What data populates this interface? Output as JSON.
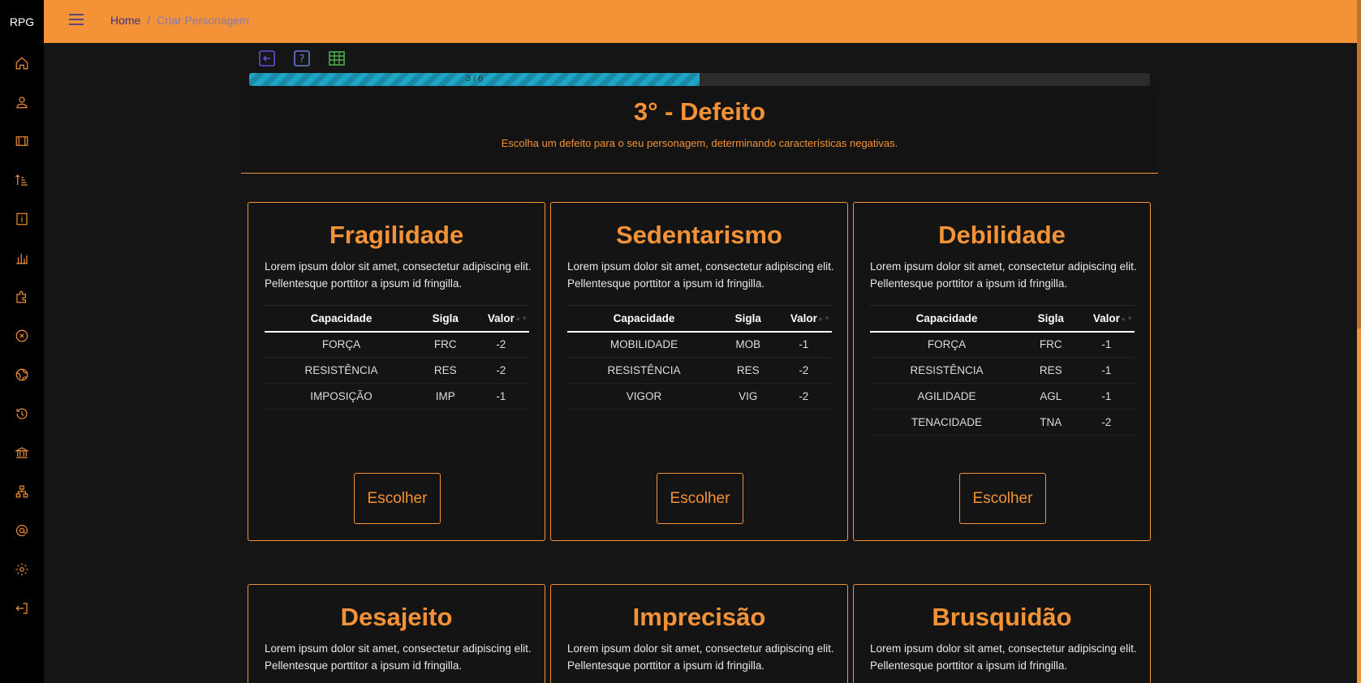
{
  "app": {
    "brand": "RPG"
  },
  "breadcrumb": {
    "home": "Home",
    "separator": "/",
    "current": "Criar Personagem"
  },
  "sidebar": {
    "items": [
      {
        "icon": "home-icon"
      },
      {
        "icon": "user-icon"
      },
      {
        "icon": "film-icon"
      },
      {
        "icon": "sort-ascending-icon"
      },
      {
        "icon": "info-icon"
      },
      {
        "icon": "bar-chart-icon"
      },
      {
        "icon": "puzzle-icon"
      },
      {
        "icon": "close-circle-icon"
      },
      {
        "icon": "globe-icon"
      },
      {
        "icon": "history-icon"
      },
      {
        "icon": "bank-icon"
      },
      {
        "icon": "sitemap-icon"
      },
      {
        "icon": "at-icon"
      },
      {
        "icon": "gear-icon"
      },
      {
        "icon": "logout-icon"
      }
    ]
  },
  "tools": [
    {
      "icon": "back-arrow-icon"
    },
    {
      "icon": "help-icon"
    },
    {
      "icon": "table-icon"
    }
  ],
  "progress": {
    "label": "3 / 6",
    "value": 0.5
  },
  "step": {
    "title": "3° - Defeito",
    "subtitle": "Escolha um defeito para o seu personagem, determinando características negativas."
  },
  "table_headers": {
    "capacidade": "Capacidade",
    "sigla": "Sigla",
    "valor": "Valor"
  },
  "choose_label": "Escolher",
  "cards": [
    {
      "title": "Fragilidade",
      "description": "Lorem ipsum dolor sit amet, consectetur adipiscing elit. Pellentesque porttitor a ipsum id fringilla.",
      "rows": [
        {
          "capacidade": "FORÇA",
          "sigla": "FRC",
          "valor": "-2"
        },
        {
          "capacidade": "RESISTÊNCIA",
          "sigla": "RES",
          "valor": "-2"
        },
        {
          "capacidade": "IMPOSIÇÃO",
          "sigla": "IMP",
          "valor": "-1"
        }
      ]
    },
    {
      "title": "Sedentarismo",
      "description": "Lorem ipsum dolor sit amet, consectetur adipiscing elit. Pellentesque porttitor a ipsum id fringilla.",
      "rows": [
        {
          "capacidade": "MOBILIDADE",
          "sigla": "MOB",
          "valor": "-1"
        },
        {
          "capacidade": "RESISTÊNCIA",
          "sigla": "RES",
          "valor": "-2"
        },
        {
          "capacidade": "VIGOR",
          "sigla": "VIG",
          "valor": "-2"
        }
      ]
    },
    {
      "title": "Debilidade",
      "description": "Lorem ipsum dolor sit amet, consectetur adipiscing elit. Pellentesque porttitor a ipsum id fringilla.",
      "rows": [
        {
          "capacidade": "FORÇA",
          "sigla": "FRC",
          "valor": "-1"
        },
        {
          "capacidade": "RESISTÊNCIA",
          "sigla": "RES",
          "valor": "-1"
        },
        {
          "capacidade": "AGILIDADE",
          "sigla": "AGL",
          "valor": "-1"
        },
        {
          "capacidade": "TENACIDADE",
          "sigla": "TNA",
          "valor": "-2"
        }
      ]
    },
    {
      "title": "Desajeito",
      "description": "Lorem ipsum dolor sit amet, consectetur adipiscing elit. Pellentesque porttitor a ipsum id fringilla.",
      "rows": []
    },
    {
      "title": "Imprecisão",
      "description": "Lorem ipsum dolor sit amet, consectetur adipiscing elit. Pellentesque porttitor a ipsum id fringilla.",
      "rows": []
    },
    {
      "title": "Brusquidão",
      "description": "Lorem ipsum dolor sit amet, consectetur adipiscing elit. Pellentesque porttitor a ipsum id fringilla.",
      "rows": []
    }
  ],
  "colors": {
    "accent": "#f39237",
    "sidebar": "#000000",
    "background": "#151515",
    "progress": "#1ea5c4"
  }
}
